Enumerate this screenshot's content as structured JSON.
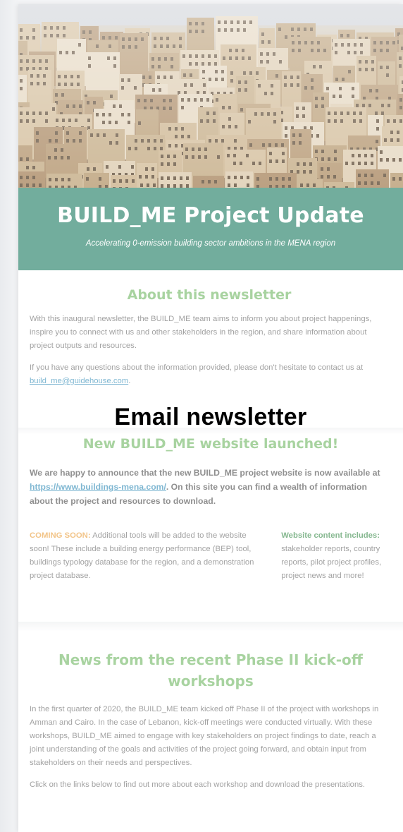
{
  "banner": {
    "title": "BUILD_ME Project Update",
    "subtitle": "Accelerating 0-emission building sector ambitions in the MENA region"
  },
  "about": {
    "title": "About this newsletter",
    "para1": "With this inaugural newsletter, the BUILD_ME team aims to inform you about project happenings, inspire you to connect with us and other stakeholders in the region, and share information about project outputs and resources.",
    "para2_prefix": "If you have any questions about the information provided, please don't hesitate to contact us at ",
    "email": "build_me@guidehouse.com",
    "para2_suffix": "."
  },
  "overlay_label": "Email newsletter",
  "website": {
    "title": "New BUILD_ME website launched!",
    "intro_prefix": "We are happy to announce that the new BUILD_ME project website is now available at ",
    "url": "https://www.buildings-mena.com/",
    "intro_suffix": ". On this site you can find a wealth of information about the project and resources to download.",
    "soon_label": "COMING SOON:",
    "soon_text": " Additional tools will be added to the website soon! These include a building energy performance (BEP) tool, buildings typology database for the region, and a demonstration project database.",
    "content_label": "Website content includes:",
    "content_text": " stakeholder reports, country reports, pilot project profiles, project news and more!"
  },
  "news": {
    "title": "News from the recent Phase II kick-off workshops",
    "para1": "In the first quarter of 2020, the BUILD_ME team kicked off Phase II of the project with workshops in Amman and Cairo. In the case of Lebanon, kick-off meetings were conducted virtually. With these workshops,  BUILD_ME aimed to engage with key stakeholders on project findings to date, reach a joint understanding of the goals and activities of the project going forward, and obtain input from stakeholders on their needs and perspectives.",
    "para2": "Click on the links below to find out more about each workshop and download the presentations."
  },
  "colors": {
    "banner_bg": "#72ad9d",
    "section_title": "#a8d3a0",
    "link": "#7fb7d2",
    "coming_soon": "#f2c488"
  }
}
